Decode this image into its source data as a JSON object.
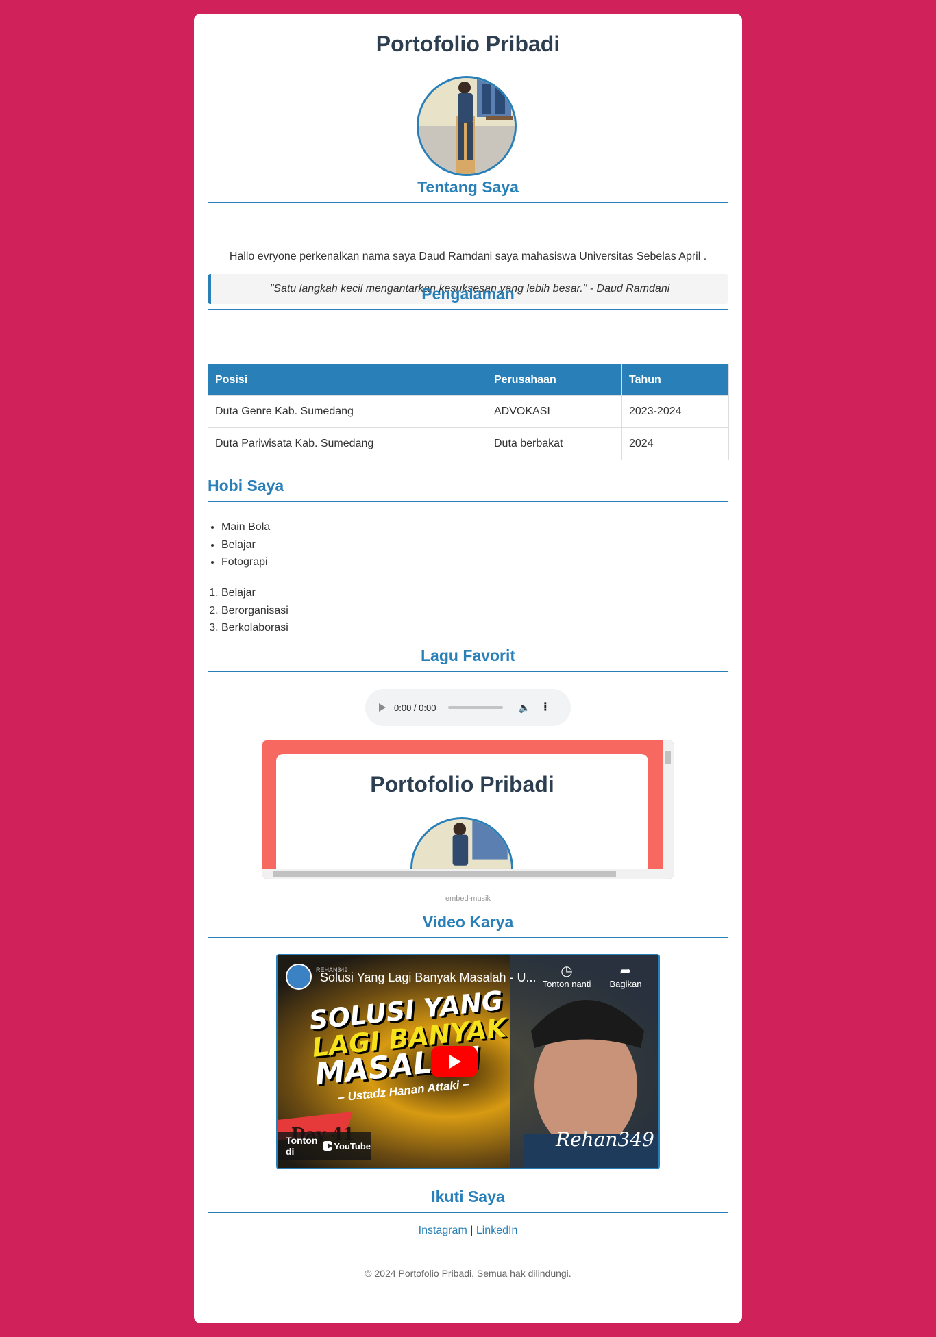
{
  "header": {
    "title": "Portofolio Pribadi"
  },
  "about": {
    "heading": "Tentang Saya",
    "text": "Hallo evryone perkenalkan nama saya Daud Ramdani saya mahasiswa Universitas Sebelas April .",
    "quote": "\"Satu langkah kecil mengantarkan kesuksesan yang lebih besar.\" - Daud Ramdani"
  },
  "experience": {
    "heading": "Pengalaman",
    "columns": [
      "Posisi",
      "Perusahaan",
      "Tahun"
    ],
    "rows": [
      [
        "Duta Genre Kab. Sumedang",
        "ADVOKASI",
        "2023-2024"
      ],
      [
        "Duta Pariwisata Kab. Sumedang",
        "Duta berbakat",
        "2024"
      ]
    ]
  },
  "hobbies": {
    "heading": "Hobi Saya",
    "bullets": [
      "Main Bola",
      "Belajar",
      "Fotograpi"
    ],
    "numbered": [
      "Belajar",
      "Berorganisasi",
      "Berkolaborasi"
    ]
  },
  "music": {
    "heading": "Lagu Favorit",
    "audio_time": "0:00 / 0:00",
    "embed_title": "Portofolio Pribadi",
    "embed_caption": "embed-musik"
  },
  "video": {
    "heading": "Video Karya",
    "channel_tag": "REHAN349",
    "title": "Solusi Yang Lagi Banyak Masalah - U...",
    "watch_later": "Tonton nanti",
    "share": "Bagikan",
    "thumb_line1": "SOLUSI YANG",
    "thumb_line2": "LAGI BANYAK",
    "thumb_line3": "MASALAH",
    "thumb_sub": "– Ustadz Hanan Attaki –",
    "thumb_day": "Day 41",
    "thumb_signature": "Rehan349",
    "watch_on": "Tonton di",
    "youtube": "YouTube"
  },
  "follow": {
    "heading": "Ikuti Saya",
    "instagram": "Instagram",
    "separator": "|",
    "linkedin": "LinkedIn"
  },
  "footer": {
    "text": "© 2024 Portofolio Pribadi. Semua hak dilindungi."
  },
  "colors": {
    "page_bg": "#d0215b",
    "accent": "#2980b9",
    "title": "#2c3e50",
    "embed_bg": "#f76860"
  }
}
